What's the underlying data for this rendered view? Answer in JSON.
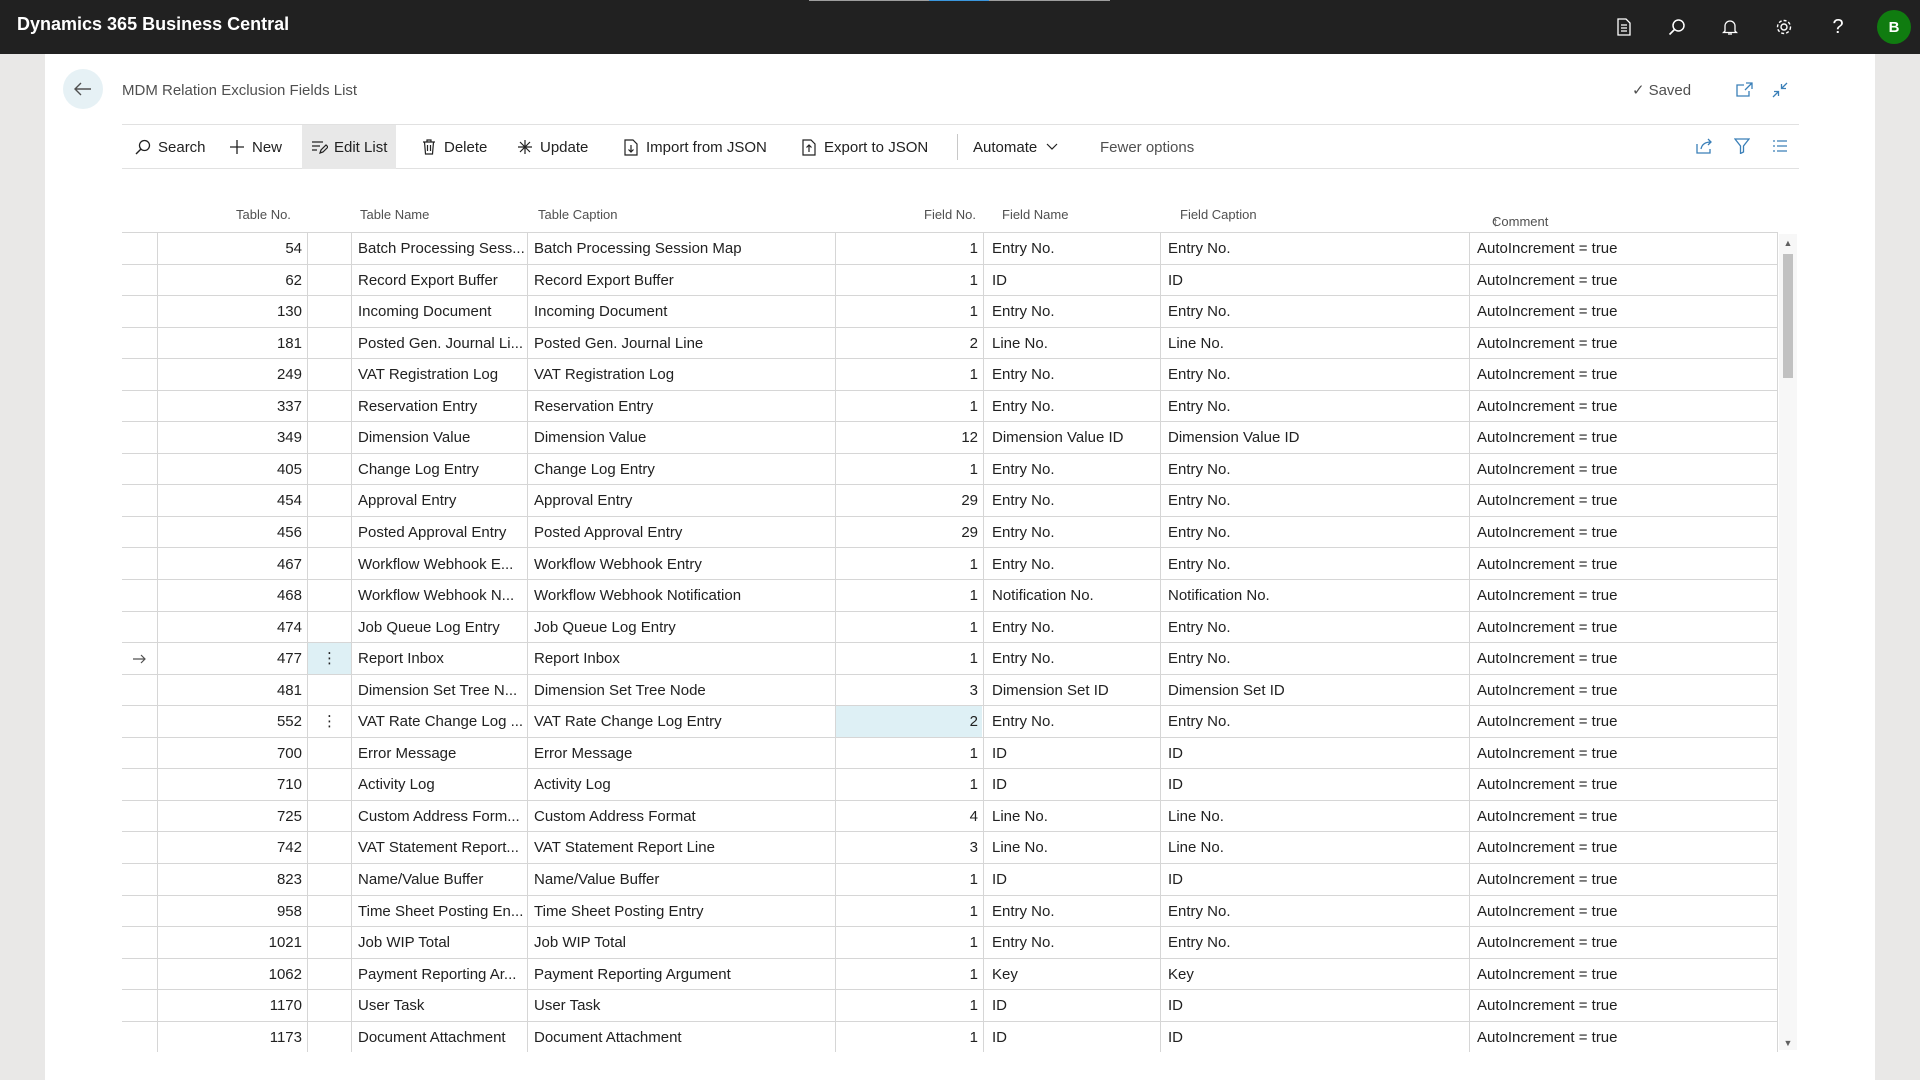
{
  "app": {
    "title": "Dynamics 365 Business Central",
    "user_initial": "B"
  },
  "header": {
    "page_title": "MDM Relation Exclusion Fields List",
    "saved_label": "Saved"
  },
  "actions": {
    "search": "Search",
    "new": "New",
    "edit_list": "Edit List",
    "delete": "Delete",
    "update": "Update",
    "import_json": "Import from JSON",
    "export_json": "Export to JSON",
    "automate": "Automate",
    "fewer_options": "Fewer options"
  },
  "columns": {
    "table_no": "Table No.",
    "table_name": "Table Name",
    "table_caption": "Table Caption",
    "field_no": "Field No.",
    "field_name": "Field Name",
    "field_caption": "Field Caption",
    "comment": "Comment",
    "comment_sort": "↑"
  },
  "rows": [
    {
      "table_no": "54",
      "table_name": "Batch Processing Sess...",
      "table_caption": "Batch Processing Session Map",
      "field_no": "1",
      "field_name": "Entry No.",
      "field_caption": "Entry No.",
      "comment": "AutoIncrement = true"
    },
    {
      "table_no": "62",
      "table_name": "Record Export Buffer",
      "table_caption": "Record Export Buffer",
      "field_no": "1",
      "field_name": "ID",
      "field_caption": "ID",
      "comment": "AutoIncrement = true"
    },
    {
      "table_no": "130",
      "table_name": "Incoming Document",
      "table_caption": "Incoming Document",
      "field_no": "1",
      "field_name": "Entry No.",
      "field_caption": "Entry No.",
      "comment": "AutoIncrement = true"
    },
    {
      "table_no": "181",
      "table_name": "Posted Gen. Journal Li...",
      "table_caption": "Posted Gen. Journal Line",
      "field_no": "2",
      "field_name": "Line No.",
      "field_caption": "Line No.",
      "comment": "AutoIncrement = true"
    },
    {
      "table_no": "249",
      "table_name": "VAT Registration Log",
      "table_caption": "VAT Registration Log",
      "field_no": "1",
      "field_name": "Entry No.",
      "field_caption": "Entry No.",
      "comment": "AutoIncrement = true"
    },
    {
      "table_no": "337",
      "table_name": "Reservation Entry",
      "table_caption": "Reservation Entry",
      "field_no": "1",
      "field_name": "Entry No.",
      "field_caption": "Entry No.",
      "comment": "AutoIncrement = true"
    },
    {
      "table_no": "349",
      "table_name": "Dimension Value",
      "table_caption": "Dimension Value",
      "field_no": "12",
      "field_name": "Dimension Value ID",
      "field_caption": "Dimension Value ID",
      "comment": "AutoIncrement = true"
    },
    {
      "table_no": "405",
      "table_name": "Change Log Entry",
      "table_caption": "Change Log Entry",
      "field_no": "1",
      "field_name": "Entry No.",
      "field_caption": "Entry No.",
      "comment": "AutoIncrement = true"
    },
    {
      "table_no": "454",
      "table_name": "Approval Entry",
      "table_caption": "Approval Entry",
      "field_no": "29",
      "field_name": "Entry No.",
      "field_caption": "Entry No.",
      "comment": "AutoIncrement = true"
    },
    {
      "table_no": "456",
      "table_name": "Posted Approval Entry",
      "table_caption": "Posted Approval Entry",
      "field_no": "29",
      "field_name": "Entry No.",
      "field_caption": "Entry No.",
      "comment": "AutoIncrement = true"
    },
    {
      "table_no": "467",
      "table_name": "Workflow Webhook E...",
      "table_caption": "Workflow Webhook Entry",
      "field_no": "1",
      "field_name": "Entry No.",
      "field_caption": "Entry No.",
      "comment": "AutoIncrement = true"
    },
    {
      "table_no": "468",
      "table_name": "Workflow Webhook N...",
      "table_caption": "Workflow Webhook Notification",
      "field_no": "1",
      "field_name": "Notification No.",
      "field_caption": "Notification No.",
      "comment": "AutoIncrement = true"
    },
    {
      "table_no": "474",
      "table_name": "Job Queue Log Entry",
      "table_caption": "Job Queue Log Entry",
      "field_no": "1",
      "field_name": "Entry No.",
      "field_caption": "Entry No.",
      "comment": "AutoIncrement = true"
    },
    {
      "table_no": "477",
      "table_name": "Report Inbox",
      "table_caption": "Report Inbox",
      "field_no": "1",
      "field_name": "Entry No.",
      "field_caption": "Entry No.",
      "comment": "AutoIncrement = true"
    },
    {
      "table_no": "481",
      "table_name": "Dimension Set Tree N...",
      "table_caption": "Dimension Set Tree Node",
      "field_no": "3",
      "field_name": "Dimension Set ID",
      "field_caption": "Dimension Set ID",
      "comment": "AutoIncrement = true"
    },
    {
      "table_no": "552",
      "table_name": "VAT Rate Change Log ...",
      "table_caption": "VAT Rate Change Log Entry",
      "field_no": "2",
      "field_name": "Entry No.",
      "field_caption": "Entry No.",
      "comment": "AutoIncrement = true"
    },
    {
      "table_no": "700",
      "table_name": "Error Message",
      "table_caption": "Error Message",
      "field_no": "1",
      "field_name": "ID",
      "field_caption": "ID",
      "comment": "AutoIncrement = true"
    },
    {
      "table_no": "710",
      "table_name": "Activity Log",
      "table_caption": "Activity Log",
      "field_no": "1",
      "field_name": "ID",
      "field_caption": "ID",
      "comment": "AutoIncrement = true"
    },
    {
      "table_no": "725",
      "table_name": "Custom Address Form...",
      "table_caption": "Custom Address Format",
      "field_no": "4",
      "field_name": "Line No.",
      "field_caption": "Line No.",
      "comment": "AutoIncrement = true"
    },
    {
      "table_no": "742",
      "table_name": "VAT Statement Report...",
      "table_caption": "VAT Statement Report Line",
      "field_no": "3",
      "field_name": "Line No.",
      "field_caption": "Line No.",
      "comment": "AutoIncrement = true"
    },
    {
      "table_no": "823",
      "table_name": "Name/Value Buffer",
      "table_caption": "Name/Value Buffer",
      "field_no": "1",
      "field_name": "ID",
      "field_caption": "ID",
      "comment": "AutoIncrement = true"
    },
    {
      "table_no": "958",
      "table_name": "Time Sheet Posting En...",
      "table_caption": "Time Sheet Posting Entry",
      "field_no": "1",
      "field_name": "Entry No.",
      "field_caption": "Entry No.",
      "comment": "AutoIncrement = true"
    },
    {
      "table_no": "1021",
      "table_name": "Job WIP Total",
      "table_caption": "Job WIP Total",
      "field_no": "1",
      "field_name": "Entry No.",
      "field_caption": "Entry No.",
      "comment": "AutoIncrement = true"
    },
    {
      "table_no": "1062",
      "table_name": "Payment Reporting Ar...",
      "table_caption": "Payment Reporting Argument",
      "field_no": "1",
      "field_name": "Key",
      "field_caption": "Key",
      "comment": "AutoIncrement = true"
    },
    {
      "table_no": "1170",
      "table_name": "User Task",
      "table_caption": "User Task",
      "field_no": "1",
      "field_name": "ID",
      "field_caption": "ID",
      "comment": "AutoIncrement = true"
    },
    {
      "table_no": "1173",
      "table_name": "Document Attachment",
      "table_caption": "Document Attachment",
      "field_no": "1",
      "field_name": "ID",
      "field_caption": "ID",
      "comment": "AutoIncrement = true"
    }
  ],
  "current_row_index": 13,
  "selected_cell": {
    "row_index": 15,
    "column": "field_no"
  }
}
